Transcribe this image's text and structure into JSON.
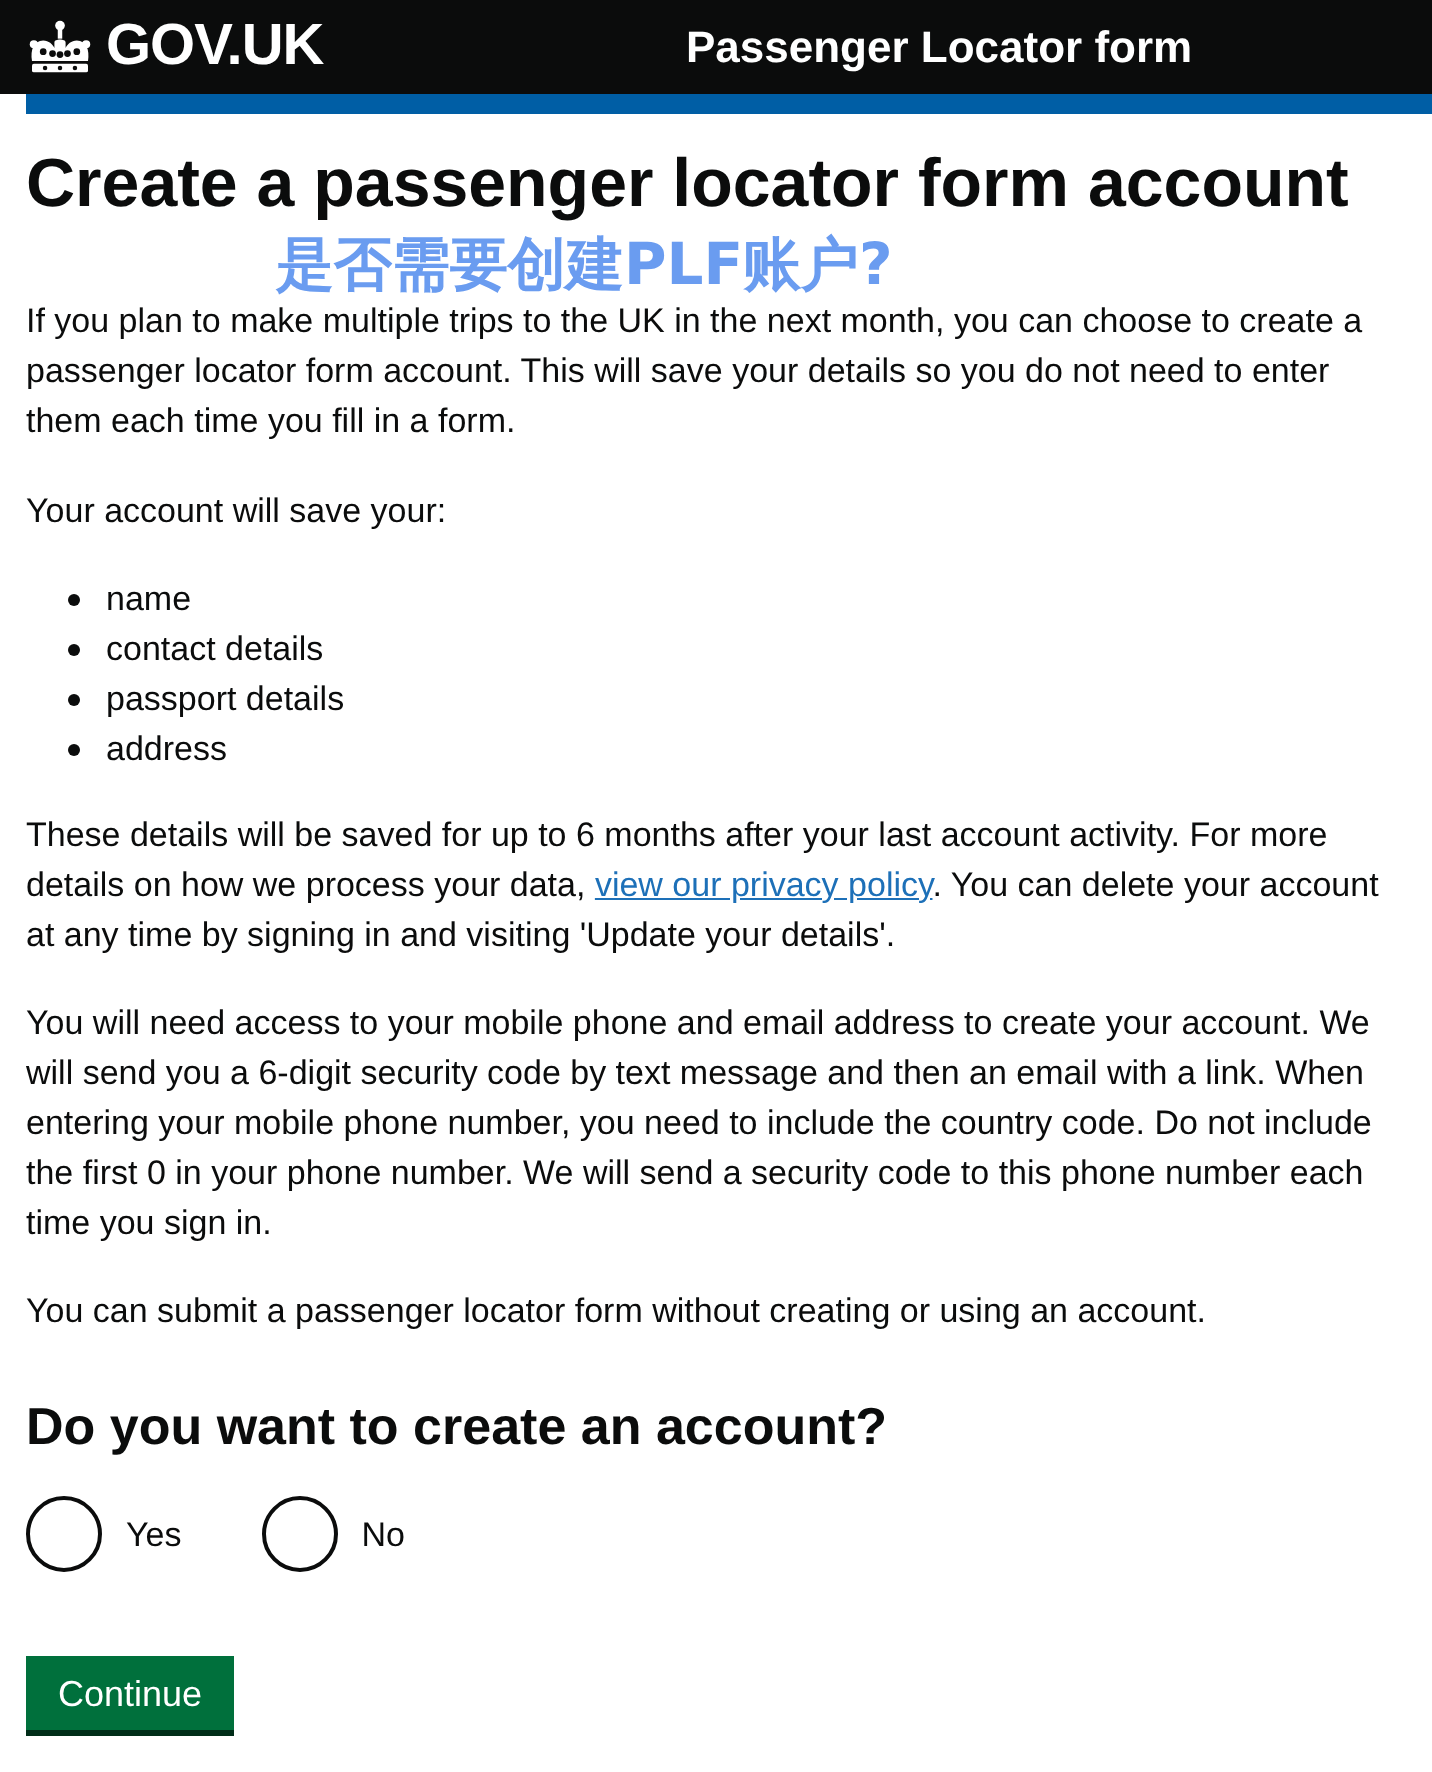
{
  "header": {
    "logo_text": "GOV.UK",
    "service_name": "Passenger Locator form"
  },
  "page": {
    "title": "Create a passenger locator form account",
    "annotation": "是否需要创建PLF账户?",
    "content": [
      {
        "kind": "paragraph",
        "text": "If you plan to make multiple trips to the UK in the next month, you can choose to create a passenger locator form account. This will save your details so you do not need to enter them each time you fill in a form."
      },
      {
        "kind": "paragraph",
        "text": "Your account will save your:"
      },
      {
        "kind": "bullet_list",
        "items": [
          "name",
          "contact details",
          "passport details",
          "address"
        ]
      },
      {
        "kind": "paragraph",
        "text": "These details will be saved for up to 6 months after your last account activity. For more details on how we process your data, ",
        "link": "view our privacy policy",
        "text_after": ". You can delete your account at any time by signing in and visiting 'Update your details'."
      },
      {
        "kind": "paragraph",
        "text": "You will need access to your mobile phone and email address to create your account. We will send you a 6-digit security code by text message and then an email with a link. When entering your mobile phone number, you need to include the country code. Do not include the first 0 in your phone number. We will send a security code to this phone number each time you sign in."
      },
      {
        "kind": "paragraph",
        "text": "You can submit a passenger locator form without creating or using an account."
      }
    ]
  },
  "question": {
    "title": "Do you want to create an account?",
    "options": [
      {
        "label": "Yes",
        "selected": false
      },
      {
        "label": "No",
        "selected": false
      }
    ]
  },
  "submit_button": {
    "label": "Continue"
  }
}
